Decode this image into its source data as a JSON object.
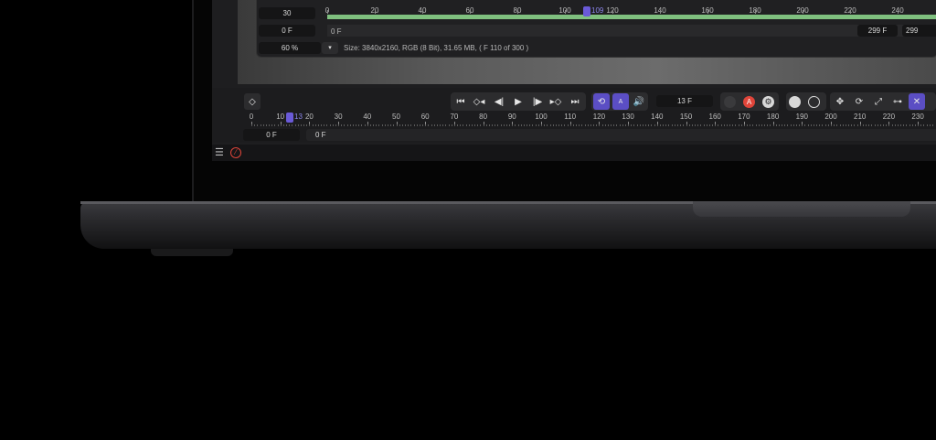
{
  "viewer": {
    "fps_field": "30",
    "frame_field_left": "0 F",
    "zoom_field": "60 %",
    "ruler_start_label": "0 F",
    "range_end_field": "299 F",
    "range_end_field_2": "299",
    "status_text": "Size: 3840x2160, RGB (8 Bit), 31.65 MB,  ( F 110 of 300 )",
    "playhead_value": "109",
    "ticks": [
      "0",
      "20",
      "40",
      "60",
      "80",
      "100",
      "120",
      "140",
      "160",
      "180",
      "200",
      "220",
      "240"
    ]
  },
  "timeline": {
    "current_frame_field": "13 F",
    "playhead_value": "13",
    "range_start_field": "0 F",
    "range_start_field_2": "0 F",
    "ticks": [
      "0",
      "10",
      "20",
      "30",
      "40",
      "50",
      "60",
      "70",
      "80",
      "90",
      "100",
      "110",
      "120",
      "130",
      "140",
      "150",
      "160",
      "170",
      "180",
      "190",
      "200",
      "210",
      "220",
      "230"
    ]
  },
  "icons": {
    "keyframe": "diamond-icon",
    "go_start": "skip-back-icon",
    "prev_key": "prev-keyframe-icon",
    "step_back": "step-back-icon",
    "play": "play-icon",
    "step_fwd": "step-forward-icon",
    "next_key": "next-keyframe-icon",
    "go_end": "skip-forward-icon",
    "loop": "loop-icon",
    "audio_mode": "audio-mode-icon",
    "volume": "volume-icon",
    "record": "record-icon",
    "auto_key": "auto-key-icon",
    "settings": "gear-icon",
    "menu": "menu-icon",
    "no_entry": "no-entry-icon"
  },
  "colors": {
    "accent": "#5b4ec4",
    "playhead": "#6a5ad8",
    "progress_green": "#7fc07f",
    "record_red": "#e0453a"
  }
}
